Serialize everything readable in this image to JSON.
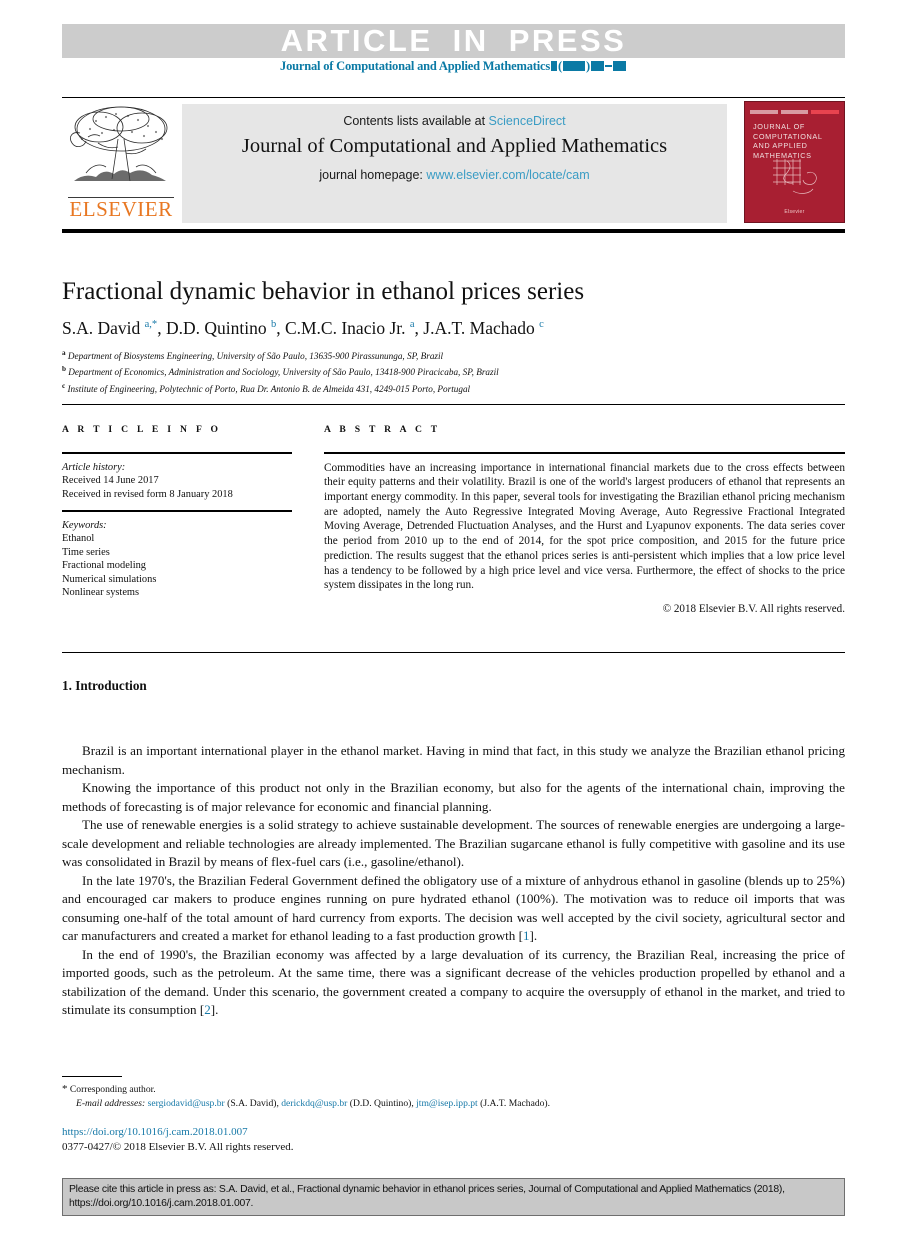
{
  "banner": {
    "article_in_press": "ARTICLE IN PRESS",
    "journal_ref_prefix": "Journal of Computational and Applied Mathematics"
  },
  "masthead": {
    "contents_prefix": "Contents lists available at ",
    "sciencedirect": "ScienceDirect",
    "journal_title": "Journal of Computational and Applied Mathematics",
    "homepage_prefix": "journal homepage: ",
    "homepage_url": "www.elsevier.com/locate/cam",
    "publisher_wordmark": "ELSEVIER",
    "cover_title": "JOURNAL OF COMPUTATIONAL AND APPLIED MATHEMATICS",
    "cover_footer": "Elsevier"
  },
  "article": {
    "title": "Fractional dynamic behavior in ethanol prices series",
    "authors_html": "S.A. David <sup>a,*</sup>, D.D. Quintino <sup>b</sup>, C.M.C. Inacio Jr. <sup>a</sup>, J.A.T. Machado <sup>c</sup>",
    "affiliations": [
      {
        "marker": "a",
        "text": "Department of Biosystems Engineering, University of São Paulo, 13635-900 Pirassununga, SP, Brazil"
      },
      {
        "marker": "b",
        "text": "Department of Economics, Administration and Sociology, University of São Paulo, 13418-900 Piracicaba, SP, Brazil"
      },
      {
        "marker": "c",
        "text": "Institute of Engineering, Polytechnic of Porto, Rua Dr. Antonio B. de Almeida 431, 4249-015 Porto, Portugal"
      }
    ]
  },
  "article_info": {
    "heading": "A R T I C L E   I N F O",
    "history_label": "Article history:",
    "history_lines": [
      "Received 14 June 2017",
      "Received in revised form 8 January 2018"
    ],
    "keywords_label": "Keywords:",
    "keywords": [
      "Ethanol",
      "Time series",
      "Fractional modeling",
      "Numerical simulations",
      "Nonlinear systems"
    ]
  },
  "abstract": {
    "heading": "A B S T R A C T",
    "body": "Commodities have an increasing importance in international financial markets due to the cross effects between their equity patterns and their volatility. Brazil is one of the world's largest producers of ethanol that represents an important energy commodity. In this paper, several tools for investigating the Brazilian ethanol pricing mechanism are adopted, namely the Auto Regressive Integrated Moving Average, Auto Regressive Fractional Integrated Moving Average, Detrended Fluctuation Analyses, and the Hurst and Lyapunov exponents. The data series cover the period from 2010 up to the end of 2014, for the spot price composition, and 2015 for the future price prediction. The results suggest that the ethanol prices series is anti-persistent which implies that a low price level has a tendency to be followed by a high price level and vice versa. Furthermore, the effect of shocks to the price system dissipates in the long run.",
    "copyright": "© 2018 Elsevier B.V. All rights reserved."
  },
  "introduction": {
    "heading": "1. Introduction",
    "paragraphs": [
      "Brazil is an important international player in the ethanol market. Having in mind that fact, in this study we analyze the Brazilian ethanol pricing mechanism.",
      "Knowing the importance of this product not only in the Brazilian economy, but also for the agents of the international chain, improving the methods of forecasting is of major relevance for economic and financial planning.",
      "The use of renewable energies is a solid strategy to achieve sustainable development. The sources of renewable energies are undergoing a large-scale development and reliable technologies are already implemented. The Brazilian sugarcane ethanol is fully competitive with gasoline and its use was consolidated in Brazil by means of flex-fuel cars (i.e., gasoline/ethanol).",
      "In the late 1970's, the Brazilian Federal Government defined the obligatory use of a mixture of anhydrous ethanol in gasoline (blends up to 25%) and encouraged car makers to produce engines running on pure hydrated ethanol (100%). The motivation was to reduce oil imports that was consuming one-half of the total amount of hard currency from exports. The decision was well accepted by the civil society, agricultural sector and car manufacturers and created a market for ethanol leading to a fast production growth [1].",
      "In the end of 1990's, the Brazilian economy was affected by a large devaluation of its currency, the Brazilian Real, increasing the price of imported goods, such as the petroleum. At the same time, there was a significant decrease of the vehicles production propelled by ethanol and a stabilization of the demand. Under this scenario, the government created a company to acquire the oversupply of ethanol in the market, and tried to stimulate its consumption [2]."
    ],
    "citation_refs": [
      "1",
      "2"
    ]
  },
  "footnotes": {
    "corresponding_marker": "*",
    "corresponding_text": "Corresponding author.",
    "email_label": "E-mail addresses:",
    "emails": [
      {
        "address": "sergiodavid@usp.br",
        "owner": "(S.A. David)"
      },
      {
        "address": "derickdq@usp.br",
        "owner": "(D.D. Quintino)"
      },
      {
        "address": "jtm@isep.ipp.pt",
        "owner": "(J.A.T. Machado)"
      }
    ],
    "doi": "https://doi.org/10.1016/j.cam.2018.01.007",
    "issn_line": "0377-0427/© 2018 Elsevier B.V. All rights reserved."
  },
  "cite_box": {
    "text": "Please cite this article in press as: S.A. David, et al., Fractional dynamic behavior in ethanol prices series, Journal of Computational and Applied Mathematics (2018), https://doi.org/10.1016/j.cam.2018.01.007."
  },
  "colors": {
    "banner_bg": "#cccccc",
    "link_blue": "#1779a8",
    "masthead_link": "#3a9cc4",
    "elsevier_orange": "#e87722",
    "cover_red": "#a81f32",
    "masthead_bg": "#e6e6e6",
    "cite_bg": "#c8c8c8"
  }
}
